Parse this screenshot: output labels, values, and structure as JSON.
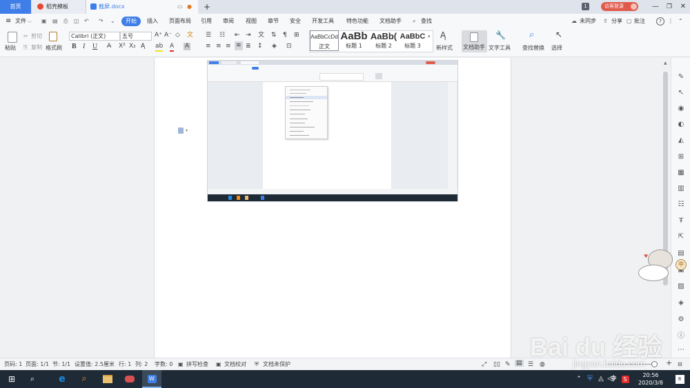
{
  "titlebar": {
    "tab_home": "首页",
    "tab_daoke": "稻壳模板",
    "tab_doc": "截屏.docx",
    "new_tab": "+",
    "badge": "1",
    "login": "访客登录",
    "minimize": "—",
    "restore": "❐",
    "close": "✕"
  },
  "menubar": {
    "file": "文件",
    "items": [
      "开始",
      "插入",
      "页面布局",
      "引用",
      "审阅",
      "视图",
      "章节",
      "安全",
      "开发工具",
      "特色功能",
      "文档助手"
    ],
    "search": "查找",
    "sync": "未同步",
    "share": "分享",
    "comment": "批注",
    "help": "?",
    "more": "⋮"
  },
  "ribbon": {
    "paste": "粘贴",
    "cut": "剪切",
    "copy": "复制",
    "format_painter": "格式刷",
    "font_name": "Calibri (正文)",
    "font_size": "五号",
    "bold": "B",
    "italic": "I",
    "underline": "U",
    "styles": [
      {
        "preview": "AaBbCcDd",
        "label": "正文"
      },
      {
        "preview": "AaBb",
        "label": "标题 1"
      },
      {
        "preview": "AaBb(",
        "label": "标题 2"
      },
      {
        "preview": "AaBbC",
        "label": "标题 3"
      }
    ],
    "new_style": "新样式",
    "doc_assistant": "文档助手",
    "text_tools": "文字工具",
    "find_replace": "查找替换",
    "select": "选择"
  },
  "statusbar": {
    "page_num": "页码: 1",
    "pages": "页面: 1/1",
    "section": "节: 1/1",
    "setting": "设置值: 2.5厘米",
    "row": "行: 1",
    "col": "列: 2",
    "words": "字数: 0",
    "spell": "拼写检查",
    "proof": "文档校对",
    "protect": "文档未保护",
    "zoom_plus": "+"
  },
  "taskbar": {
    "time": "20:56",
    "date": "2020/3/8",
    "ime": "中",
    "notify_count": "8"
  },
  "watermark": {
    "brand": "Bai du 经验",
    "url": "jingyan.baidu.com"
  },
  "colors": {
    "accent": "#3f7ee8",
    "login_badge": "#e05a4c",
    "taskbar": "#1e2a36"
  }
}
